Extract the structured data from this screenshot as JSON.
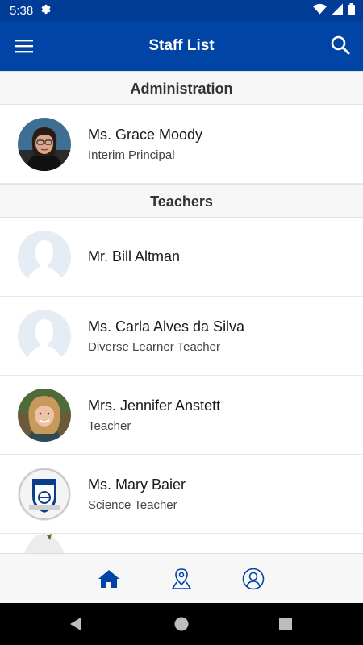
{
  "status_bar": {
    "time": "5:38"
  },
  "app_bar": {
    "title": "Staff List"
  },
  "sections": [
    {
      "title": "Administration",
      "staff": [
        {
          "name": "Ms. Grace Moody",
          "title": "Interim Principal",
          "avatar": "photo"
        }
      ]
    },
    {
      "title": "Teachers",
      "staff": [
        {
          "name": "Mr. Bill Altman",
          "title": "",
          "avatar": "placeholder"
        },
        {
          "name": "Ms. Carla Alves da Silva",
          "title": "Diverse Learner Teacher",
          "avatar": "placeholder"
        },
        {
          "name": "Mrs. Jennifer Anstett",
          "title": "Teacher",
          "avatar": "photo"
        },
        {
          "name": "Ms. Mary Baier",
          "title": "Science Teacher",
          "avatar": "school-logo"
        }
      ]
    }
  ],
  "icons": {
    "status": [
      "gear-icon",
      "wifi-icon",
      "signal-icon",
      "battery-icon"
    ],
    "app_bar": [
      "menu-icon",
      "search-icon"
    ],
    "bottom_nav": [
      "home-icon",
      "map-pin-icon",
      "profile-icon"
    ],
    "system_nav": [
      "back-icon",
      "home-circle-icon",
      "recents-icon"
    ]
  },
  "colors": {
    "app_bar": "#0044a6",
    "status_bar": "#003b95",
    "nav_icon": "#0044a6",
    "section_background": "#f6f6f6",
    "placeholder_avatar": "#e6ecf5"
  }
}
